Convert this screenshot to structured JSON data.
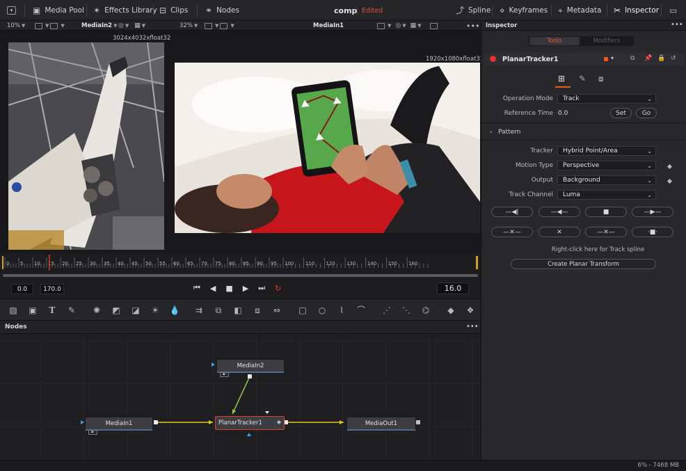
{
  "toolbar": {
    "media_pool": "Media Pool",
    "effects_library": "Effects Library",
    "clips": "Clips",
    "nodes": "Nodes",
    "comp_title": "comp",
    "edited_status": "Edited",
    "spline": "Spline",
    "keyframes": "Keyframes",
    "metadata": "Metadata",
    "inspector": "Inspector"
  },
  "viewer_bar": {
    "left_zoom": "10%",
    "left_clip": "MediaIn2",
    "right_zoom": "32%",
    "right_clip": "MediaIn1"
  },
  "viewers": {
    "left_resolution": "3024x4032xfloat32",
    "right_resolution": "1920x1080xfloat32"
  },
  "timeline": {
    "ticks": [
      "0",
      "5",
      "10",
      "15",
      "20",
      "25",
      "30",
      "35",
      "40",
      "45",
      "50",
      "55",
      "60",
      "65",
      "70",
      "75",
      "80",
      "85",
      "90",
      "95",
      "100",
      "110",
      "120",
      "130",
      "140",
      "150",
      "160"
    ],
    "playhead": 16,
    "start": "0.0",
    "end": "170.0",
    "current": "16.0"
  },
  "nodes_panel": {
    "title": "Nodes",
    "nodes": {
      "mediain2": "MediaIn2",
      "mediain1": "MediaIn1",
      "planartracker1": "PlanarTracker1",
      "mediaout1": "MediaOut1"
    }
  },
  "inspector": {
    "title": "Inspector",
    "tabs": [
      "Tools",
      "Modifiers"
    ],
    "tool_name": "PlanarTracker1",
    "operation_mode_label": "Operation Mode",
    "operation_mode": "Track",
    "reference_time_label": "Reference Time",
    "reference_time": "0.0",
    "set_label": "Set",
    "go_label": "Go",
    "pattern_label": "Pattern",
    "tracker_label": "Tracker",
    "tracker": "Hybrid Point/Area",
    "motion_type_label": "Motion Type",
    "motion_type": "Perspective",
    "output_label": "Output",
    "output": "Background",
    "track_channel_label": "Track Channel",
    "track_channel": "Luma",
    "hint": "Right-click here for Track spline",
    "create_transform": "Create Planar Transform",
    "accent_color": "#e9591c"
  },
  "status": {
    "memory": "6% - 7468 MB"
  }
}
